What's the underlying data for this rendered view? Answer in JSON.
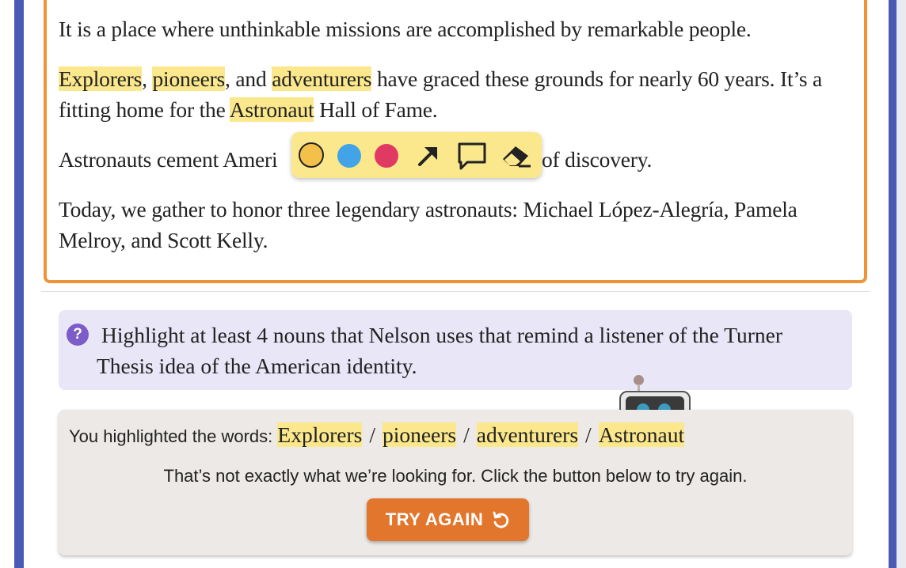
{
  "passage": {
    "line1": "It is a place where unthinkable missions are accomplished by remarkable people.",
    "p2": {
      "w1": "Explorers",
      "s1": ", ",
      "w2": "pioneers",
      "s2": ", and ",
      "w3": "adventurers",
      "s3": " have graced these grounds for nearly 60 years. It’s a fitting home for the ",
      "w4": "Astronaut",
      "s4": " Hall of Fame."
    },
    "p3": {
      "before": "Astronauts cement Ameri",
      "after": "of discovery."
    },
    "p4": "Today, we gather to honor three legendary astronauts: Michael López-Alegría, Pamela Melroy, and Scott Kelly."
  },
  "toolbar": {
    "tools": [
      {
        "name": "yellow-highlighter-icon",
        "color": "#f3c04a"
      },
      {
        "name": "blue-highlighter-icon",
        "color": "#42a3e6"
      },
      {
        "name": "red-highlighter-icon",
        "color": "#e03a63"
      },
      {
        "name": "arrow-icon"
      },
      {
        "name": "comment-icon"
      },
      {
        "name": "eraser-icon"
      }
    ]
  },
  "question": {
    "icon": "?",
    "text": "Highlight at least 4 nouns that Nelson uses that remind a listener of the Turner Thesis idea of the American identity."
  },
  "feedback": {
    "prefix": "You highlighted the words: ",
    "words": [
      "Explorers",
      "pioneers",
      "adventurers",
      "Astronaut"
    ],
    "separator": "/",
    "message": "That’s not exactly what we’re looking for. Click the button below to try again.",
    "button_label": "TRY AGAIN"
  },
  "colors": {
    "accent_border": "#ee9436",
    "highlight": "#fbe88c",
    "sidebar": "#4a5bb5",
    "button": "#e2762c",
    "question_bg": "#e8e6f7"
  }
}
